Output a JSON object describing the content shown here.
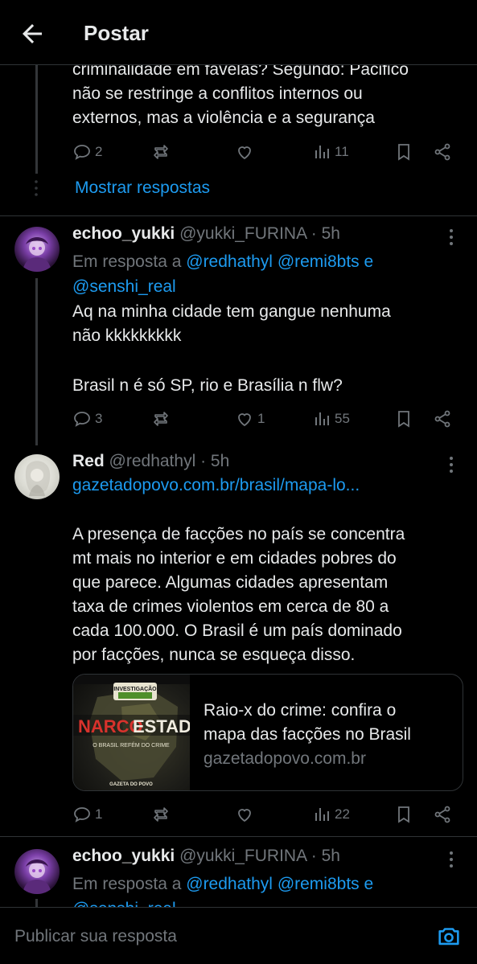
{
  "header": {
    "title": "Postar"
  },
  "tweet0": {
    "lines": [
      "criminalidade em favelas? Segundo: Pacifico",
      "não se restringe a conflitos internos ou",
      "externos, mas a violência e a segurança"
    ],
    "replies": "2",
    "retweets": "",
    "likes": "",
    "views": "11",
    "show_replies": "Mostrar respostas"
  },
  "tweet1": {
    "name": "echoo_yukki",
    "handle": "@yukki_FURINA",
    "time": "· 5h",
    "reply_prefix": "Em resposta a",
    "mention1": "@redhathyl",
    "mention2": "@remi8bts",
    "conj": "e",
    "mention3": "@senshi_real",
    "line1": "Aq na minha cidade tem gangue nenhuma",
    "line2": "não kkkkkkkkk",
    "line3": "Brasil n é só SP, rio e Brasília n flw?",
    "replies": "3",
    "likes": "1",
    "views": "55"
  },
  "tweet2": {
    "name": "Red",
    "handle": "@redhathyl",
    "time": "· 5h",
    "url": "gazetadopovo.com.br/brasil/mapa-lo...",
    "lines": [
      "A presença de facções no país se concentra",
      "mt mais no interior e em cidades pobres do",
      "que parece. Algumas cidades apresentam",
      "taxa de crimes violentos em cerca de 80 a",
      "cada 100.000. O Brasil é um país dominado",
      "por facções, nunca se esqueça disso."
    ],
    "card": {
      "title1": "Raio-x do crime: confira o",
      "title2": "mapa das facções no Brasil",
      "domain": "gazetadopovo.com.br",
      "thumb_badge": "INVESTIGAÇÃO",
      "thumb_title_a": "NARCO",
      "thumb_title_b": "ESTADO",
      "thumb_subtitle": "O BRASIL REFÉM DO CRIME",
      "thumb_logo": "GAZETA DO POVO"
    },
    "replies": "1",
    "views": "22"
  },
  "tweet3": {
    "name": "echoo_yukki",
    "handle": "@yukki_FURINA",
    "time": "· 5h",
    "reply_prefix": "Em resposta a",
    "mention1": "@redhathyl",
    "mention2": "@remi8bts",
    "conj": "e",
    "mention3": "@senshi_real"
  },
  "reply_bar": {
    "placeholder": "Publicar sua resposta"
  },
  "colors": {
    "accent": "#1d9bf0",
    "muted": "#71767b",
    "text": "#e7e9ea",
    "bg": "#000000"
  }
}
